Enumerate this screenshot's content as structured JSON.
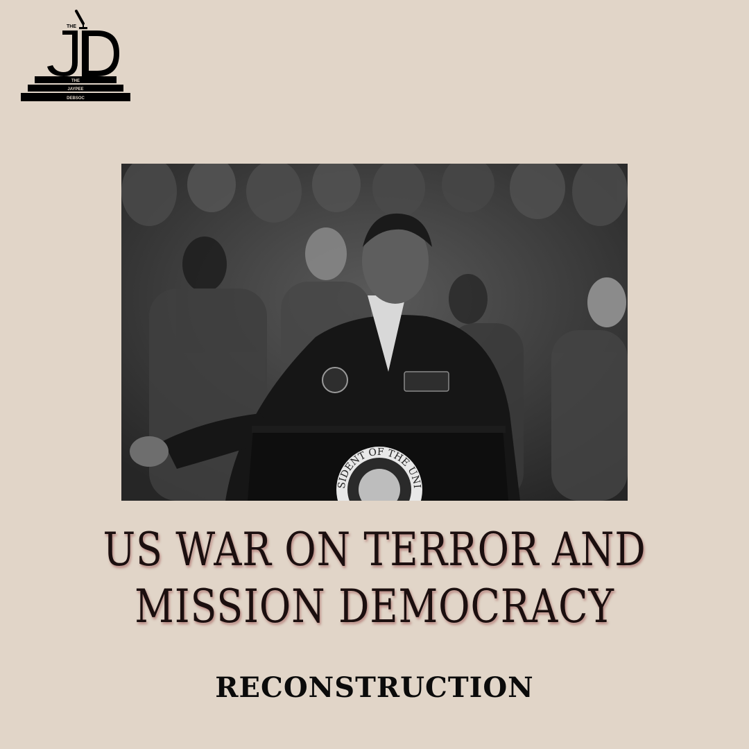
{
  "logo": {
    "name": "The Jaypee Debsoc",
    "top_word": "THE",
    "initials": "JD",
    "step_lines": [
      "THE",
      "JAYPEE",
      "DEBSOC"
    ]
  },
  "photo": {
    "description_icon": "speaker-at-podium-photo",
    "seal_text": "PRESIDENT OF THE UNITED"
  },
  "title": {
    "line1": "US WAR ON TERROR AND",
    "line2": "MISSION DEMOCRACY"
  },
  "subtitle": "RECONSTRUCTION",
  "colors": {
    "background": "#e1d5c8",
    "title_text": "#1b0f0f",
    "title_shadow": "#964646",
    "photo_dark": "#2a2a2a"
  }
}
